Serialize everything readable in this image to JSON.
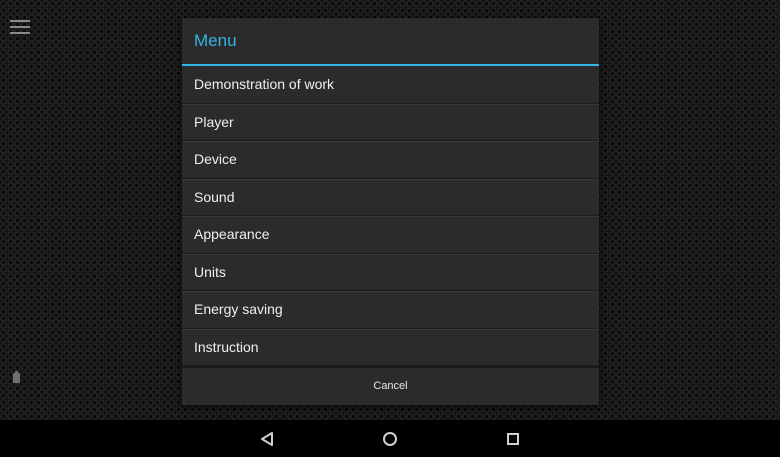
{
  "dialog": {
    "title": "Menu",
    "items": [
      {
        "label": "Demonstration of work"
      },
      {
        "label": "Player"
      },
      {
        "label": "Device"
      },
      {
        "label": "Sound"
      },
      {
        "label": "Appearance"
      },
      {
        "label": "Units"
      },
      {
        "label": "Energy saving"
      },
      {
        "label": "Instruction"
      }
    ],
    "cancel_label": "Cancel"
  },
  "icons": {
    "menu": "hamburger-menu-icon",
    "battery": "battery-icon",
    "back": "back-triangle-icon",
    "home": "home-circle-icon",
    "recent": "recent-apps-square-icon"
  },
  "colors": {
    "accent": "#33b5e5",
    "dialog_bg": "#2b2b2b",
    "navbar_bg": "#000000"
  }
}
